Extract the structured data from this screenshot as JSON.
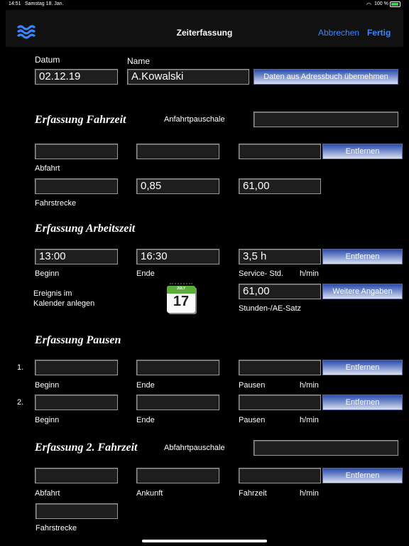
{
  "status": {
    "time": "14:51",
    "date": "Samstag 18. Jan.",
    "battery": "100 %"
  },
  "nav": {
    "title": "Zeiterfassung",
    "cancel": "Abbrechen",
    "done": "Fertig"
  },
  "header": {
    "datum_label": "Datum",
    "datum_value": "02.12.19",
    "name_label": "Name",
    "name_value": "A.Kowalski",
    "address_button": "Daten aus Adressbuch übernehmen"
  },
  "travel": {
    "title": "Erfassung Fahrzeit",
    "flat_rate_label": "Anfahrtpauschale",
    "flat_rate_value": "",
    "row1": {
      "field1": "",
      "field2": "",
      "field3": ""
    },
    "remove": "Entfernen",
    "departure_label": "Abfahrt",
    "row2": {
      "field1": "",
      "field2": "0,85",
      "field3": "61,00"
    },
    "distance_label": "Fahrstrecke"
  },
  "work": {
    "title": "Erfassung Arbeitszeit",
    "start": "13:00",
    "end": "16:30",
    "service": "3,5 h",
    "remove": "Entfernen",
    "start_label": "Beginn",
    "end_label": "Ende",
    "service_label": "Service- Std.",
    "unit": "h/min",
    "calendar_label_line1": "Ereignis im",
    "calendar_label_line2": "Kalender anlegen",
    "calendar_month": "JULY",
    "calendar_day": "17",
    "rate_value": "61,00",
    "more_button": "Weitere Angaben",
    "rate_label": "Stunden-/AE-Satz"
  },
  "breaks": {
    "title": "Erfassung Pausen",
    "rows": [
      {
        "index": "1.",
        "start": "",
        "end": "",
        "pause": "",
        "remove": "Entfernen",
        "start_label": "Beginn",
        "end_label": "Ende",
        "pause_label": "Pausen",
        "unit": "h/min"
      },
      {
        "index": "2.",
        "start": "",
        "end": "",
        "pause": "",
        "remove": "Entfernen",
        "start_label": "Beginn",
        "end_label": "Ende",
        "pause_label": "Pausen",
        "unit": "h/min"
      }
    ]
  },
  "travel2": {
    "title": "Erfassung 2. Fahrzeit",
    "flat_rate_label": "Abfahrtpauschale",
    "flat_rate_value": "",
    "departure": "",
    "arrival": "",
    "duration": "",
    "remove": "Entfernen",
    "departure_label": "Abfahrt",
    "arrival_label": "Ankunft",
    "duration_label": "Fahrzeit",
    "unit": "h/min",
    "distance_value": "",
    "distance_label": "Fahrstrecke"
  },
  "colors": {
    "accent": "#3a86ff",
    "background": "#000000",
    "field": "#1e1e1e"
  }
}
